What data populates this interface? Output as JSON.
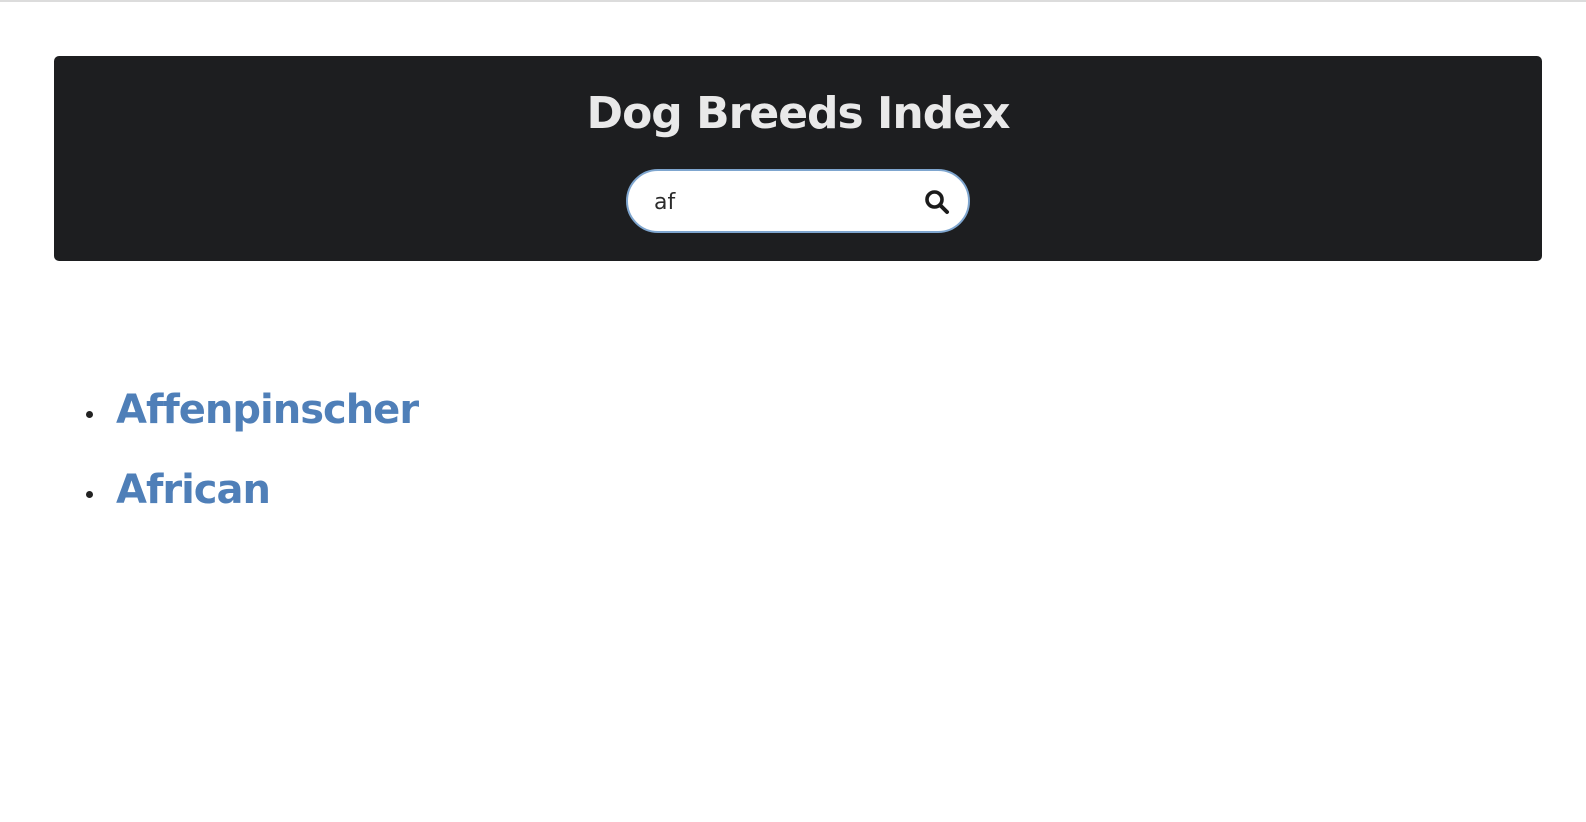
{
  "header": {
    "title": "Dog Breeds Index"
  },
  "search": {
    "value": "af",
    "icon": "search-icon"
  },
  "results": {
    "items": [
      {
        "label": "Affenpinscher"
      },
      {
        "label": "African"
      }
    ]
  },
  "colors": {
    "header_bg": "#1d1e20",
    "title": "#e9e9e9",
    "link": "#4f7fb8",
    "search_border": "#7fa6cf"
  }
}
